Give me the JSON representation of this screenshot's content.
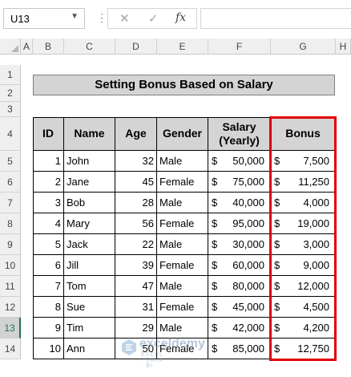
{
  "formula_bar": {
    "name_box": "U13",
    "fx_label": "fx",
    "cancel_glyph": "✕",
    "enter_glyph": "✓",
    "formula_value": ""
  },
  "columns": [
    "A",
    "B",
    "C",
    "D",
    "E",
    "F",
    "G",
    "H"
  ],
  "rows": [
    "1",
    "2",
    "3",
    "4",
    "5",
    "6",
    "7",
    "8",
    "9",
    "10",
    "11",
    "12",
    "13",
    "14"
  ],
  "selected_row": "13",
  "title": "Setting Bonus Based on Salary",
  "headers": {
    "id": "ID",
    "name": "Name",
    "age": "Age",
    "gender": "Gender",
    "salary_line1": "Salary",
    "salary_line2": "(Yearly)",
    "bonus": "Bonus"
  },
  "currency_symbol": "$",
  "records": [
    {
      "id": "1",
      "name": "John",
      "age": "32",
      "gender": "Male",
      "salary": "50,000",
      "bonus": "7,500"
    },
    {
      "id": "2",
      "name": "Jane",
      "age": "45",
      "gender": "Female",
      "salary": "75,000",
      "bonus": "11,250"
    },
    {
      "id": "3",
      "name": "Bob",
      "age": "28",
      "gender": "Male",
      "salary": "40,000",
      "bonus": "4,000"
    },
    {
      "id": "4",
      "name": "Mary",
      "age": "56",
      "gender": "Female",
      "salary": "95,000",
      "bonus": "19,000"
    },
    {
      "id": "5",
      "name": "Jack",
      "age": "22",
      "gender": "Male",
      "salary": "30,000",
      "bonus": "3,000"
    },
    {
      "id": "6",
      "name": "Jill",
      "age": "39",
      "gender": "Female",
      "salary": "60,000",
      "bonus": "9,000"
    },
    {
      "id": "7",
      "name": "Tom",
      "age": "47",
      "gender": "Male",
      "salary": "80,000",
      "bonus": "12,000"
    },
    {
      "id": "8",
      "name": "Sue",
      "age": "31",
      "gender": "Female",
      "salary": "45,000",
      "bonus": "4,500"
    },
    {
      "id": "9",
      "name": "Tim",
      "age": "29",
      "gender": "Male",
      "salary": "42,000",
      "bonus": "4,200"
    },
    {
      "id": "10",
      "name": "Ann",
      "age": "50",
      "gender": "Female",
      "salary": "85,000",
      "bonus": "12,750"
    }
  ],
  "watermark": {
    "name": "exceldemy",
    "tagline": "EXCEL · DATA · BI"
  },
  "colors": {
    "highlight_border": "#e00000",
    "header_fill": "#d4d4d4",
    "selected_row_accent": "#217346"
  }
}
